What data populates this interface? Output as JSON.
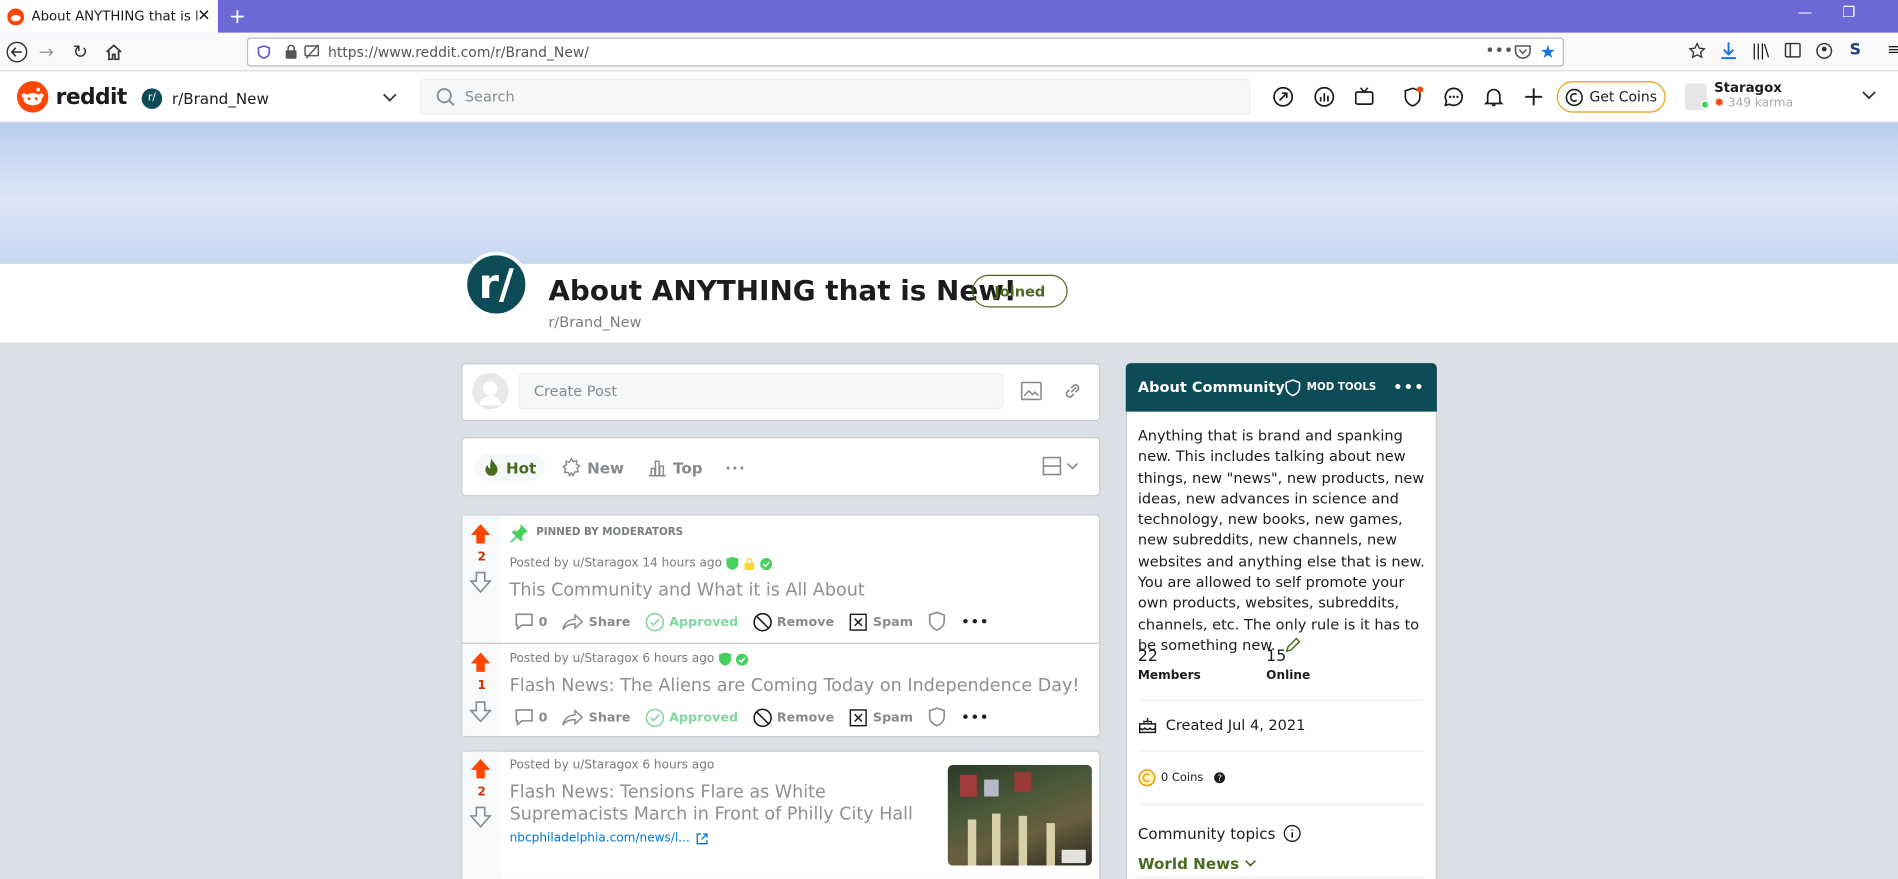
{
  "browser": {
    "tab_title": "About ANYTHING that is New!",
    "url": "https://www.reddit.com/r/Brand_New/"
  },
  "header": {
    "logo_text": "reddit",
    "community": "r/Brand_New",
    "search_placeholder": "Search",
    "get_coins": "Get Coins",
    "username": "Staragox",
    "karma": "349 karma"
  },
  "sub": {
    "icon_text": "r/",
    "title": "About ANYTHING that is New!",
    "name": "r/Brand_New",
    "joined": "Joined"
  },
  "create_post": {
    "placeholder": "Create Post"
  },
  "sort": {
    "hot": "Hot",
    "new": "New",
    "top": "Top",
    "more": "···"
  },
  "posts": [
    {
      "pinned": "PINNED BY MODERATORS",
      "meta": "Posted by u/Staragox 14 hours ago",
      "title": "This Community and What it is All About",
      "score": "2",
      "comments": "0",
      "share": "Share",
      "approved": "Approved",
      "remove": "Remove",
      "spam": "Spam"
    },
    {
      "meta": "Posted by u/Staragox 6 hours ago",
      "title": "Flash News: The Aliens are Coming Today on Independence Day!",
      "score": "1",
      "comments": "0",
      "share": "Share",
      "approved": "Approved",
      "remove": "Remove",
      "spam": "Spam"
    },
    {
      "meta": "Posted by u/Staragox 6 hours ago",
      "title": "Flash News: Tensions Flare as White Supremacists March in Front of Philly City Hall",
      "score": "2",
      "link": "nbcphiladelphia.com/news/l..."
    }
  ],
  "about": {
    "heading": "About Community",
    "mod_tools": "MOD TOOLS",
    "description": "Anything that is brand and spanking new. This includes talking about new things, new \"news\", new products, new ideas, new advances in science and technology, new books, new games, new subreddits, new channels, new websites and anything else that is new. You are allowed to self promote your own products, websites, subreddits, channels, etc. The only rule is it has to be something new.",
    "members": "22",
    "members_label": "Members",
    "online": "15",
    "online_label": "Online",
    "created": "Created Jul 4, 2021",
    "coins": "0 Coins",
    "topics_label": "Community topics",
    "topic": "World News"
  },
  "colors": {
    "tabbar": "#6b69d6",
    "accent": "#0d4b57",
    "upvote": "#ff4500",
    "approved": "#46d160"
  }
}
